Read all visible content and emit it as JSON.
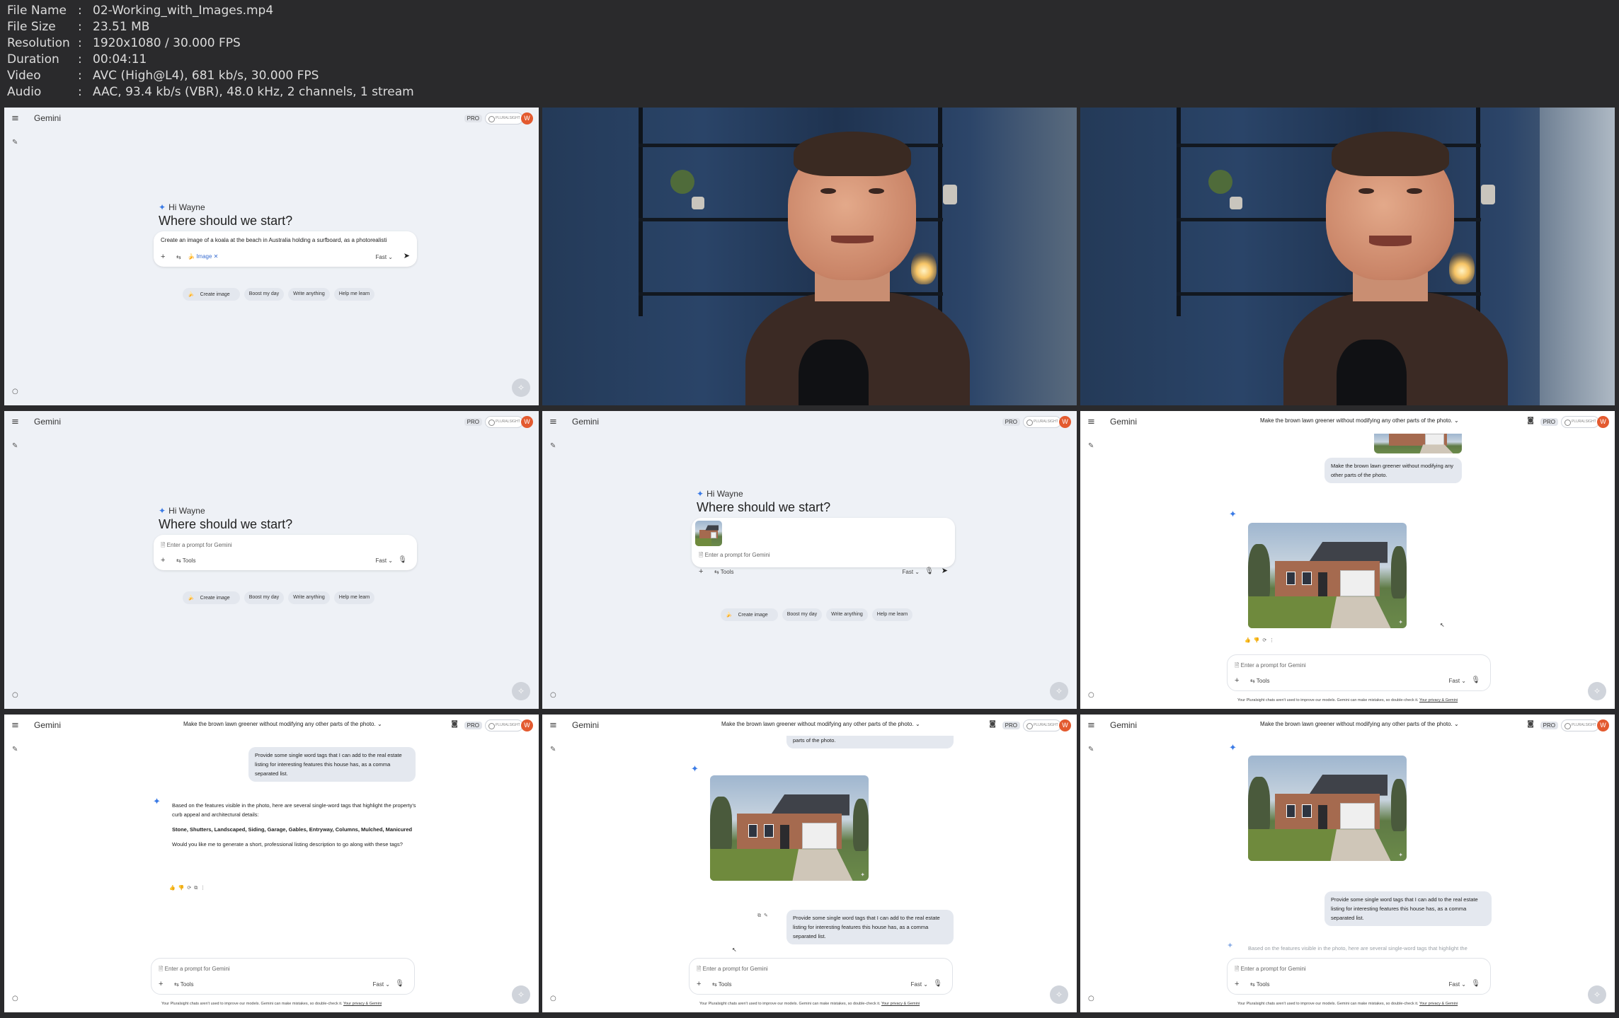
{
  "file_info": [
    {
      "key": "File Name",
      "value": "02-Working_with_Images.mp4"
    },
    {
      "key": "File Size",
      "value": "23.51 MB"
    },
    {
      "key": "Resolution",
      "value": "1920x1080 / 30.000 FPS"
    },
    {
      "key": "Duration",
      "value": "00:04:11"
    },
    {
      "key": "Video",
      "value": "AVC (High@L4), 681 kb/s, 30.000 FPS"
    },
    {
      "key": "Audio",
      "value": "AAC, 93.4 kb/s (VBR), 48.0 kHz, 2 channels, 1 stream"
    }
  ],
  "gemini": {
    "app_title": "Gemini",
    "pro_label": "PRO",
    "pluralsight_label": "PLURALSIGHT",
    "avatar_initial": "W",
    "greeting": "Hi Wayne",
    "headline": "Where should we start?",
    "placeholder": "Enter a prompt for Gemini",
    "tools_label": "Tools",
    "mode_label": "Fast",
    "image_chip_label": "Image",
    "typed_prompt": "Create an image of a koala at the beach in Australia holding a surfboard, as a photorealisti",
    "suggestions": [
      "Create image",
      "Boost my day",
      "Write anything",
      "Help me learn"
    ],
    "conversation_title": "Make the brown lawn greener without modifying any other parts of the photo.",
    "user_msg_lawn": "Make the brown lawn greener without modifying any other parts of the photo.",
    "user_msg_tags": "Provide some single word tags that I can add to the real estate listing for interesting features this house has, as a comma separated list.",
    "user_msg_tail": "parts of the photo.",
    "response_intro": "Based on the features visible in the photo, here are several single-word tags that highlight the property's curb appeal and architectural details:",
    "response_tags": "Stone, Shutters, Landscaped, Siding, Garage, Gables, Entryway, Columns, Mulched, Manicured",
    "response_question": "Would you like me to generate a short, professional listing description to go along with these tags?",
    "response_streaming": "Based on the features visible in the photo, here are several single-word tags that highlight the",
    "footer": "Your Pluralsight chats aren't used to improve our models. Gemini can make mistakes, so double-check it.",
    "footer_link": "Your privacy & Gemini"
  },
  "icons": {
    "menu": "menu-icon",
    "edit": "new-chat-icon",
    "settings": "settings-icon",
    "spark": "gemini-spark-icon",
    "send": "send-icon",
    "mic": "mic-icon"
  }
}
